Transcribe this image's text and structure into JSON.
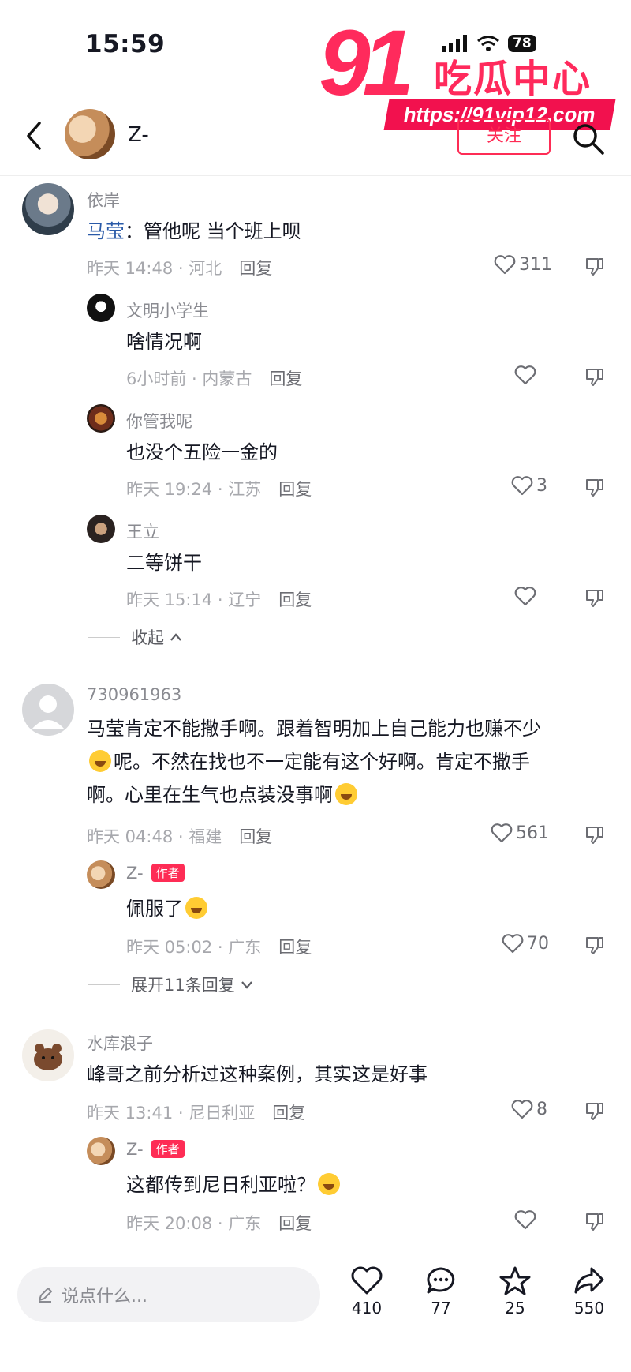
{
  "status": {
    "time": "15:59",
    "battery": "78"
  },
  "watermark": {
    "brand_number": "91",
    "brand_cn": "吃瓜中心",
    "url": "https://91vip12.com"
  },
  "header": {
    "name": "Z-",
    "follow": "关注"
  },
  "comments": [
    {
      "name": "依岸",
      "mention": "马莹",
      "text": "：管他呢 当个班上呗",
      "time": "昨天 14:48 · 河北",
      "reply": "回复",
      "likes": "311",
      "replies": [
        {
          "name": "文明小学生",
          "text": "啥情况啊",
          "time": "6小时前 · 内蒙古",
          "reply": "回复",
          "likes": ""
        },
        {
          "name": "你管我呢",
          "text": "也没个五险一金的",
          "time": "昨天 19:24 · 江苏",
          "reply": "回复",
          "likes": "3"
        },
        {
          "name": "王立",
          "text": "二等饼干",
          "time": "昨天 15:14 · 辽宁",
          "reply": "回复",
          "likes": ""
        }
      ],
      "collapse": "收起"
    },
    {
      "name": "730961963",
      "text_lines": [
        "马莹肯定不能撒手啊。跟着智明加上自己能力也赚不少",
        "呢。不然在找也不一定能有这个好啊。肯定不撒手",
        "啊。心里在生气也点装没事啊"
      ],
      "time": "昨天 04:48 · 福建",
      "reply": "回复",
      "likes": "561",
      "replies": [
        {
          "name": "Z-",
          "tag": "作者",
          "text": "佩服了",
          "time": "昨天 05:02 · 广东",
          "reply": "回复",
          "likes": "70"
        }
      ],
      "expand": "展开11条回复"
    },
    {
      "name": "水库浪子",
      "text": "峰哥之前分析过这种案例，其实这是好事",
      "time": "昨天 13:41 · 尼日利亚",
      "reply": "回复",
      "likes": "8",
      "replies": [
        {
          "name": "Z-",
          "tag": "作者",
          "text": "这都传到尼日利亚啦？",
          "time": "昨天 20:08 · 广东",
          "reply": "回复",
          "likes": ""
        }
      ]
    }
  ],
  "bottom": {
    "placeholder": "说点什么...",
    "likes": "410",
    "comments": "77",
    "favorites": "25",
    "shares": "550"
  }
}
